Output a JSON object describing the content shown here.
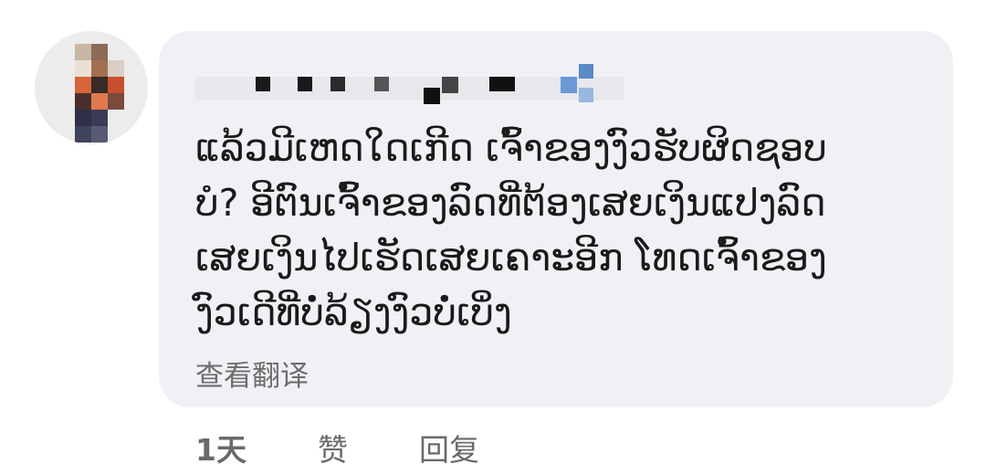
{
  "comment": {
    "text": "ແລ້ວມີເຫດໃດເກີດ ເຈົ້າຂອງງົວຮັບຜິດຊອບ\nບໍ? ອີຕົນເຈົ້າຂອງລົດທີ່ຕ້ອງເສຍເງິນແປງລົດ\nເສຍເງິນໄປເຮັດເສຍເຄາະອີກ ໂທດເຈົ້າຂອງ\nງົວເດີທີ່ບໍ່ລ້ຽງງົວບໍ່ເບິ່ງ",
    "translate_label": "查看翻译"
  },
  "actions": {
    "time": "1天",
    "like_label": "赞",
    "reply_label": "回复"
  },
  "colors": {
    "bubble_bg": "#f0f1f5",
    "text": "#1a1a1a",
    "muted": "#6d6d6d"
  }
}
